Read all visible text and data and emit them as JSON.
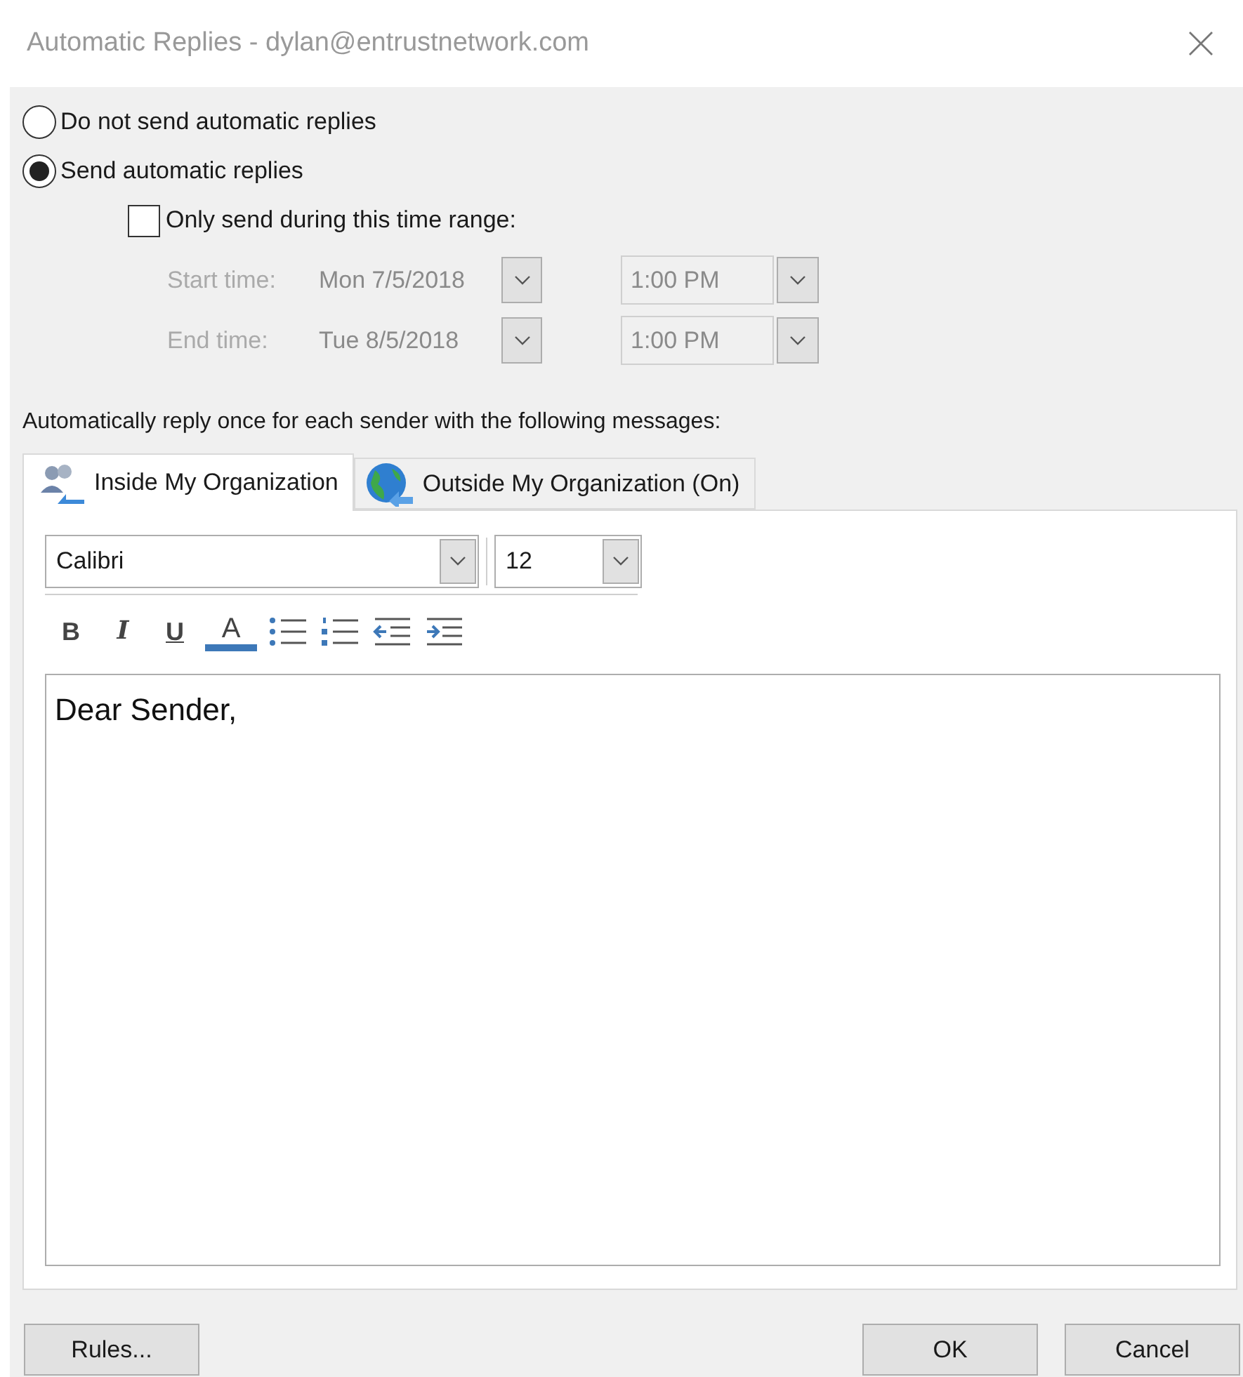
{
  "window": {
    "title": "Automatic Replies - dylan@entrustnetwork.com"
  },
  "modes": [
    {
      "label": "Do not send automatic replies",
      "selected": false
    },
    {
      "label": "Send automatic replies",
      "selected": true
    }
  ],
  "time_range": {
    "label": "Only send during this time range:",
    "checked": false,
    "disabled": true,
    "rows": [
      {
        "label": "Start time:",
        "date": "Mon 7/5/2018",
        "time": "1:00 PM"
      },
      {
        "label": "End time:",
        "date": "Tue 8/5/2018",
        "time": "1:00 PM"
      }
    ]
  },
  "instruction": "Automatically reply once for each sender with the following messages:",
  "tabs": [
    {
      "label": "Inside My Organization",
      "kind": "people",
      "selected": true
    },
    {
      "label": "Outside My Organization (On)",
      "kind": "globe",
      "selected": false
    }
  ],
  "editor": {
    "font": "Calibri",
    "size": "12",
    "format_buttons": [
      {
        "kind": "bold",
        "label": "B"
      },
      {
        "kind": "italic",
        "label": "I"
      },
      {
        "kind": "underline",
        "label": "U"
      },
      {
        "kind": "color",
        "label": "A"
      },
      {
        "kind": "bullets"
      },
      {
        "kind": "numbering"
      },
      {
        "kind": "outdent"
      },
      {
        "kind": "indent"
      }
    ],
    "text": "Dear Sender,"
  },
  "buttons": {
    "rules": "Rules...",
    "ok": "OK",
    "cancel": "Cancel"
  }
}
